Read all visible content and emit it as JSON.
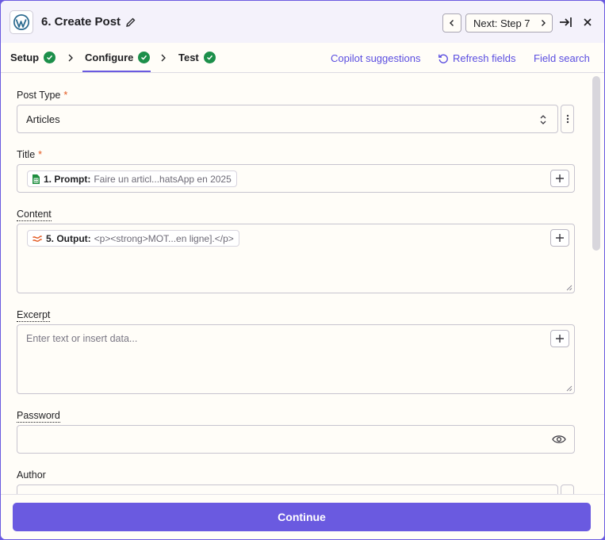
{
  "header": {
    "step_title": "6. Create Post",
    "next_label": "Next: Step 7"
  },
  "tabs": [
    {
      "label": "Setup",
      "status": "complete"
    },
    {
      "label": "Configure",
      "status": "complete",
      "active": true
    },
    {
      "label": "Test",
      "status": "complete"
    }
  ],
  "links": {
    "copilot": "Copilot suggestions",
    "refresh": "Refresh fields",
    "search": "Field search"
  },
  "fields": {
    "post_type": {
      "label": "Post Type",
      "required": "*",
      "value": "Articles"
    },
    "title": {
      "label": "Title",
      "required": "*",
      "pill_step": "1. Prompt:",
      "pill_value": "Faire un articl...hatsApp en 2025"
    },
    "content": {
      "label": "Content",
      "pill_step": "5. Output:",
      "pill_value": "<p><strong>MOT...en ligne].</p>"
    },
    "excerpt": {
      "label": "Excerpt",
      "placeholder": "Enter text or insert data..."
    },
    "password": {
      "label": "Password"
    },
    "author": {
      "label": "Author"
    }
  },
  "footer": {
    "continue_label": "Continue"
  },
  "colors": {
    "accent": "#6a5ae0",
    "success": "#1c8f4a",
    "required": "#e3581f"
  },
  "icons": [
    "wordpress-icon",
    "pencil-icon",
    "chevron-left-icon",
    "chevron-right-icon",
    "exit-icon",
    "close-icon",
    "check-circle-icon",
    "refresh-icon",
    "google-sheets-icon",
    "formatter-icon",
    "plus-icon",
    "eye-icon",
    "select-arrows-icon",
    "kebab-icon"
  ]
}
